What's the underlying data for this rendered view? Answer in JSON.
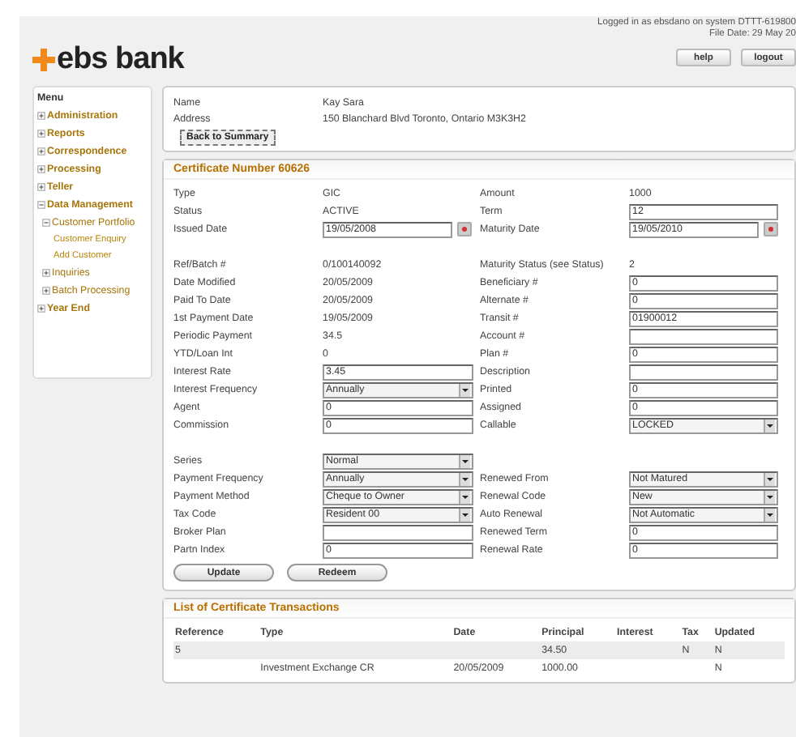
{
  "header": {
    "logo_text": "ebs bank",
    "login_info": "Logged in as ebsdano on system DTTT-619800",
    "file_date": "File Date: 29 May 20",
    "buttons": [
      "help",
      "logout"
    ]
  },
  "sidebar": {
    "title": "Menu",
    "items": [
      {
        "label": "Administration",
        "expanded": false
      },
      {
        "label": "Reports",
        "expanded": false
      },
      {
        "label": "Correspondence",
        "expanded": false
      },
      {
        "label": "Processing",
        "expanded": false
      },
      {
        "label": "Teller",
        "expanded": false
      },
      {
        "label": "Data Management",
        "expanded": true,
        "children": [
          {
            "label": "Customer Portfolio",
            "expanded": true,
            "children": [
              {
                "label": "Customer Enquiry"
              },
              {
                "label": "Add Customer"
              }
            ]
          },
          {
            "label": "Inquiries",
            "expanded": false
          },
          {
            "label": "Batch Processing",
            "expanded": false
          }
        ]
      },
      {
        "label": "Year End",
        "expanded": false
      }
    ]
  },
  "customer": {
    "fields": [
      {
        "label": "Name",
        "value": "Kay Sara"
      },
      {
        "label": "Address",
        "value": "150 Blanchard Blvd Toronto, Ontario M3K3H2"
      }
    ],
    "back_button": "Back to Summary"
  },
  "certificate": {
    "title": "Certificate Number 60626",
    "rows": [
      {
        "kind": "fields",
        "cells": [
          {
            "label": "Type",
            "kind": "text",
            "value": "GIC"
          },
          {
            "label": "Amount",
            "kind": "text",
            "value": "1000"
          }
        ]
      },
      {
        "kind": "fields",
        "cells": [
          {
            "label": "Status",
            "kind": "text",
            "value": "ACTIVE"
          },
          {
            "label": "Term",
            "kind": "input",
            "value": "12"
          }
        ]
      },
      {
        "kind": "fields",
        "cells": [
          {
            "label": "Issued Date",
            "kind": "date",
            "value": "19/05/2008"
          },
          {
            "label": "Maturity Date",
            "kind": "date",
            "value": "19/05/2010"
          }
        ]
      },
      {
        "kind": "spacer"
      },
      {
        "kind": "fields",
        "cells": [
          {
            "label": "Ref/Batch #",
            "kind": "text",
            "value": "0/100140092"
          },
          {
            "label": "Maturity Status (see Status)",
            "kind": "text",
            "value": "2"
          }
        ]
      },
      {
        "kind": "fields",
        "cells": [
          {
            "label": "Date Modified",
            "kind": "text",
            "value": "20/05/2009"
          },
          {
            "label": "Beneficiary #",
            "kind": "input",
            "value": "0"
          }
        ]
      },
      {
        "kind": "fields",
        "cells": [
          {
            "label": "Paid To Date",
            "kind": "text",
            "value": "20/05/2009"
          },
          {
            "label": "Alternate #",
            "kind": "input",
            "value": "0"
          }
        ]
      },
      {
        "kind": "fields",
        "cells": [
          {
            "label": "1st Payment Date",
            "kind": "text",
            "value": "19/05/2009"
          },
          {
            "label": "Transit #",
            "kind": "input",
            "value": "01900012"
          }
        ]
      },
      {
        "kind": "fields",
        "cells": [
          {
            "label": "Periodic Payment",
            "kind": "text",
            "value": "34.5"
          },
          {
            "label": "Account #",
            "kind": "input"
          }
        ]
      },
      {
        "kind": "fields",
        "cells": [
          {
            "label": "YTD/Loan Int",
            "kind": "text",
            "value": "0"
          },
          {
            "label": "Plan #",
            "kind": "input",
            "value": "0"
          }
        ]
      },
      {
        "kind": "fields",
        "cells": [
          {
            "label": "Interest Rate",
            "kind": "input",
            "value": "3.45"
          },
          {
            "label": "Description",
            "kind": "input"
          }
        ]
      },
      {
        "kind": "fields",
        "cells": [
          {
            "label": "Interest Frequency",
            "kind": "select",
            "value": "Annually"
          },
          {
            "label": "Printed",
            "kind": "input",
            "value": "0"
          }
        ]
      },
      {
        "kind": "fields",
        "cells": [
          {
            "label": "Agent",
            "kind": "input",
            "value": "0"
          },
          {
            "label": "Assigned",
            "kind": "input",
            "value": "0"
          }
        ]
      },
      {
        "kind": "fields",
        "cells": [
          {
            "label": "Commission",
            "kind": "input",
            "value": "0"
          },
          {
            "label": "Callable",
            "kind": "select",
            "value": "LOCKED"
          }
        ]
      },
      {
        "kind": "spacer"
      },
      {
        "kind": "fields",
        "cells": [
          {
            "label": "Series",
            "kind": "select",
            "value": "Normal"
          }
        ]
      },
      {
        "kind": "fields",
        "cells": [
          {
            "label": "Payment Frequency",
            "kind": "select",
            "value": "Annually"
          },
          {
            "label": "Renewed From",
            "kind": "select",
            "value": "Not Matured"
          }
        ]
      },
      {
        "kind": "fields",
        "cells": [
          {
            "label": "Payment Method",
            "kind": "select",
            "value": "Cheque to Owner"
          },
          {
            "label": "Renewal Code",
            "kind": "select",
            "value": "New"
          }
        ]
      },
      {
        "kind": "fields",
        "cells": [
          {
            "label": "Tax Code",
            "kind": "select",
            "value": "Resident 00"
          },
          {
            "label": "Auto Renewal",
            "kind": "select",
            "value": "Not Automatic"
          }
        ]
      },
      {
        "kind": "fields",
        "cells": [
          {
            "label": "Broker Plan",
            "kind": "input"
          },
          {
            "label": "Renewed Term",
            "kind": "input",
            "value": "0"
          }
        ]
      },
      {
        "kind": "fields",
        "cells": [
          {
            "label": "Partn Index",
            "kind": "input",
            "value": "0"
          },
          {
            "label": "Renewal Rate",
            "kind": "input",
            "value": "0"
          }
        ]
      }
    ],
    "buttons": [
      "Update",
      "Redeem"
    ]
  },
  "transactions": {
    "title": "List of Certificate Transactions",
    "columns": [
      "Reference",
      "Type",
      "Date",
      "Principal",
      "Interest",
      "Tax",
      "Updated"
    ],
    "rows": [
      {
        "selected": true,
        "cells": [
          "5",
          null,
          null,
          "34.50",
          null,
          "N",
          "N"
        ]
      },
      {
        "selected": false,
        "cells": [
          null,
          "Investment Exchange CR",
          "20/05/2009",
          "1000.00",
          null,
          null,
          "N"
        ]
      }
    ]
  }
}
